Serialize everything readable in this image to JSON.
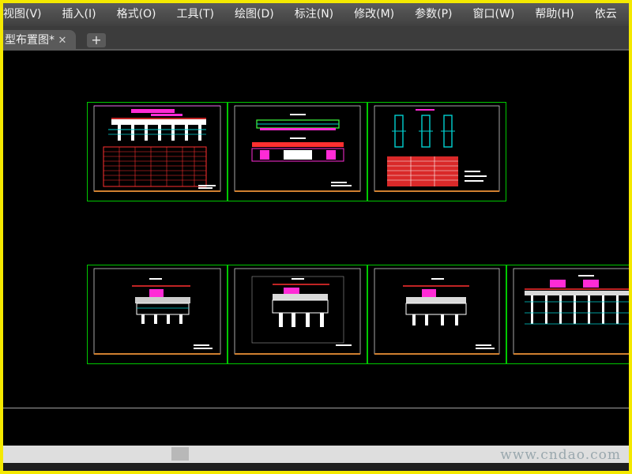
{
  "menubar": {
    "items": [
      "视图(V)",
      "插入(I)",
      "格式(O)",
      "工具(T)",
      "绘图(D)",
      "标注(N)",
      "修改(M)",
      "参数(P)",
      "窗口(W)",
      "帮助(H)",
      "依云"
    ]
  },
  "tabs": {
    "active_tab_label": "型布置图*",
    "close_glyph": "✕",
    "add_glyph": "+"
  },
  "drawing_sheets": {
    "row_1": [
      "sheet-1",
      "sheet-2",
      "sheet-3"
    ],
    "row_2": [
      "sheet-4",
      "sheet-5",
      "sheet-6",
      "sheet-7"
    ]
  },
  "watermark": "www.cndao.com",
  "colors": {
    "frame_border": "#f4e900",
    "canvas_background": "#000000",
    "sheet_border": "#00c800",
    "menubar": "#4a4a4a"
  }
}
